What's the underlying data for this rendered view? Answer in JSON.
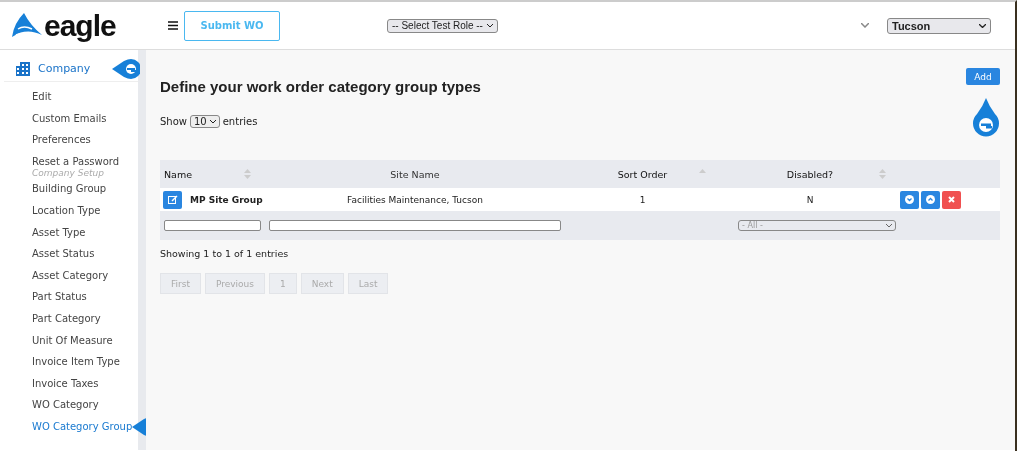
{
  "header": {
    "logo": "eagle",
    "submit_button": "Submit WO",
    "role_select": "-- Select Test Role --",
    "site_select": "Tucson"
  },
  "sidebar": {
    "heading": "Company",
    "items": [
      {
        "label": "Edit",
        "kind": "link",
        "selected": false
      },
      {
        "label": "Custom Emails",
        "kind": "link",
        "selected": false
      },
      {
        "label": "Preferences",
        "kind": "link",
        "selected": false
      },
      {
        "label": "Reset a Password",
        "kind": "link",
        "selected": false
      },
      {
        "label": "Company Setup",
        "kind": "section"
      },
      {
        "label": "Building Group",
        "kind": "link",
        "selected": false
      },
      {
        "label": "Location Type",
        "kind": "link",
        "selected": false
      },
      {
        "label": "Asset Type",
        "kind": "link",
        "selected": false
      },
      {
        "label": "Asset Status",
        "kind": "link",
        "selected": false
      },
      {
        "label": "Asset Category",
        "kind": "link",
        "selected": false
      },
      {
        "label": "Part Status",
        "kind": "link",
        "selected": false
      },
      {
        "label": "Part Category",
        "kind": "link",
        "selected": false
      },
      {
        "label": "Unit Of Measure",
        "kind": "link",
        "selected": false
      },
      {
        "label": "Invoice Item Type",
        "kind": "link",
        "selected": false
      },
      {
        "label": "Invoice Taxes",
        "kind": "link",
        "selected": false
      },
      {
        "label": "WO Category",
        "kind": "link",
        "selected": false
      },
      {
        "label": "WO Category Group",
        "kind": "link",
        "selected": true
      }
    ]
  },
  "page": {
    "title": "Define your work order category group types",
    "add_button": "Add",
    "show_label": "Show",
    "page_size": "10",
    "entries_label": "entries"
  },
  "table": {
    "columns": [
      {
        "label": "Name",
        "sortable": true,
        "sorted": false
      },
      {
        "label": "Site Name",
        "sortable": false,
        "sorted": false
      },
      {
        "label": "Sort Order",
        "sortable": true,
        "sorted": true
      },
      {
        "label": "Disabled?",
        "sortable": true,
        "sorted": false
      },
      {
        "sortable": false,
        "sorted": false
      }
    ],
    "filters": [
      {
        "kind": "text"
      },
      {
        "kind": "text"
      },
      {
        "kind": "blank"
      },
      {
        "kind": "select",
        "value": "- All -"
      },
      {
        "kind": "blank"
      }
    ],
    "rows": [
      {
        "name": "MP Site Group",
        "site_name": "Facilities Maintenance, Tucson",
        "sort_order": "1",
        "disabled": "N"
      }
    ]
  },
  "info": "Showing 1 to 1 of 1 entries",
  "pagination": [
    "First",
    "Previous",
    "1",
    "Next",
    "Last"
  ]
}
